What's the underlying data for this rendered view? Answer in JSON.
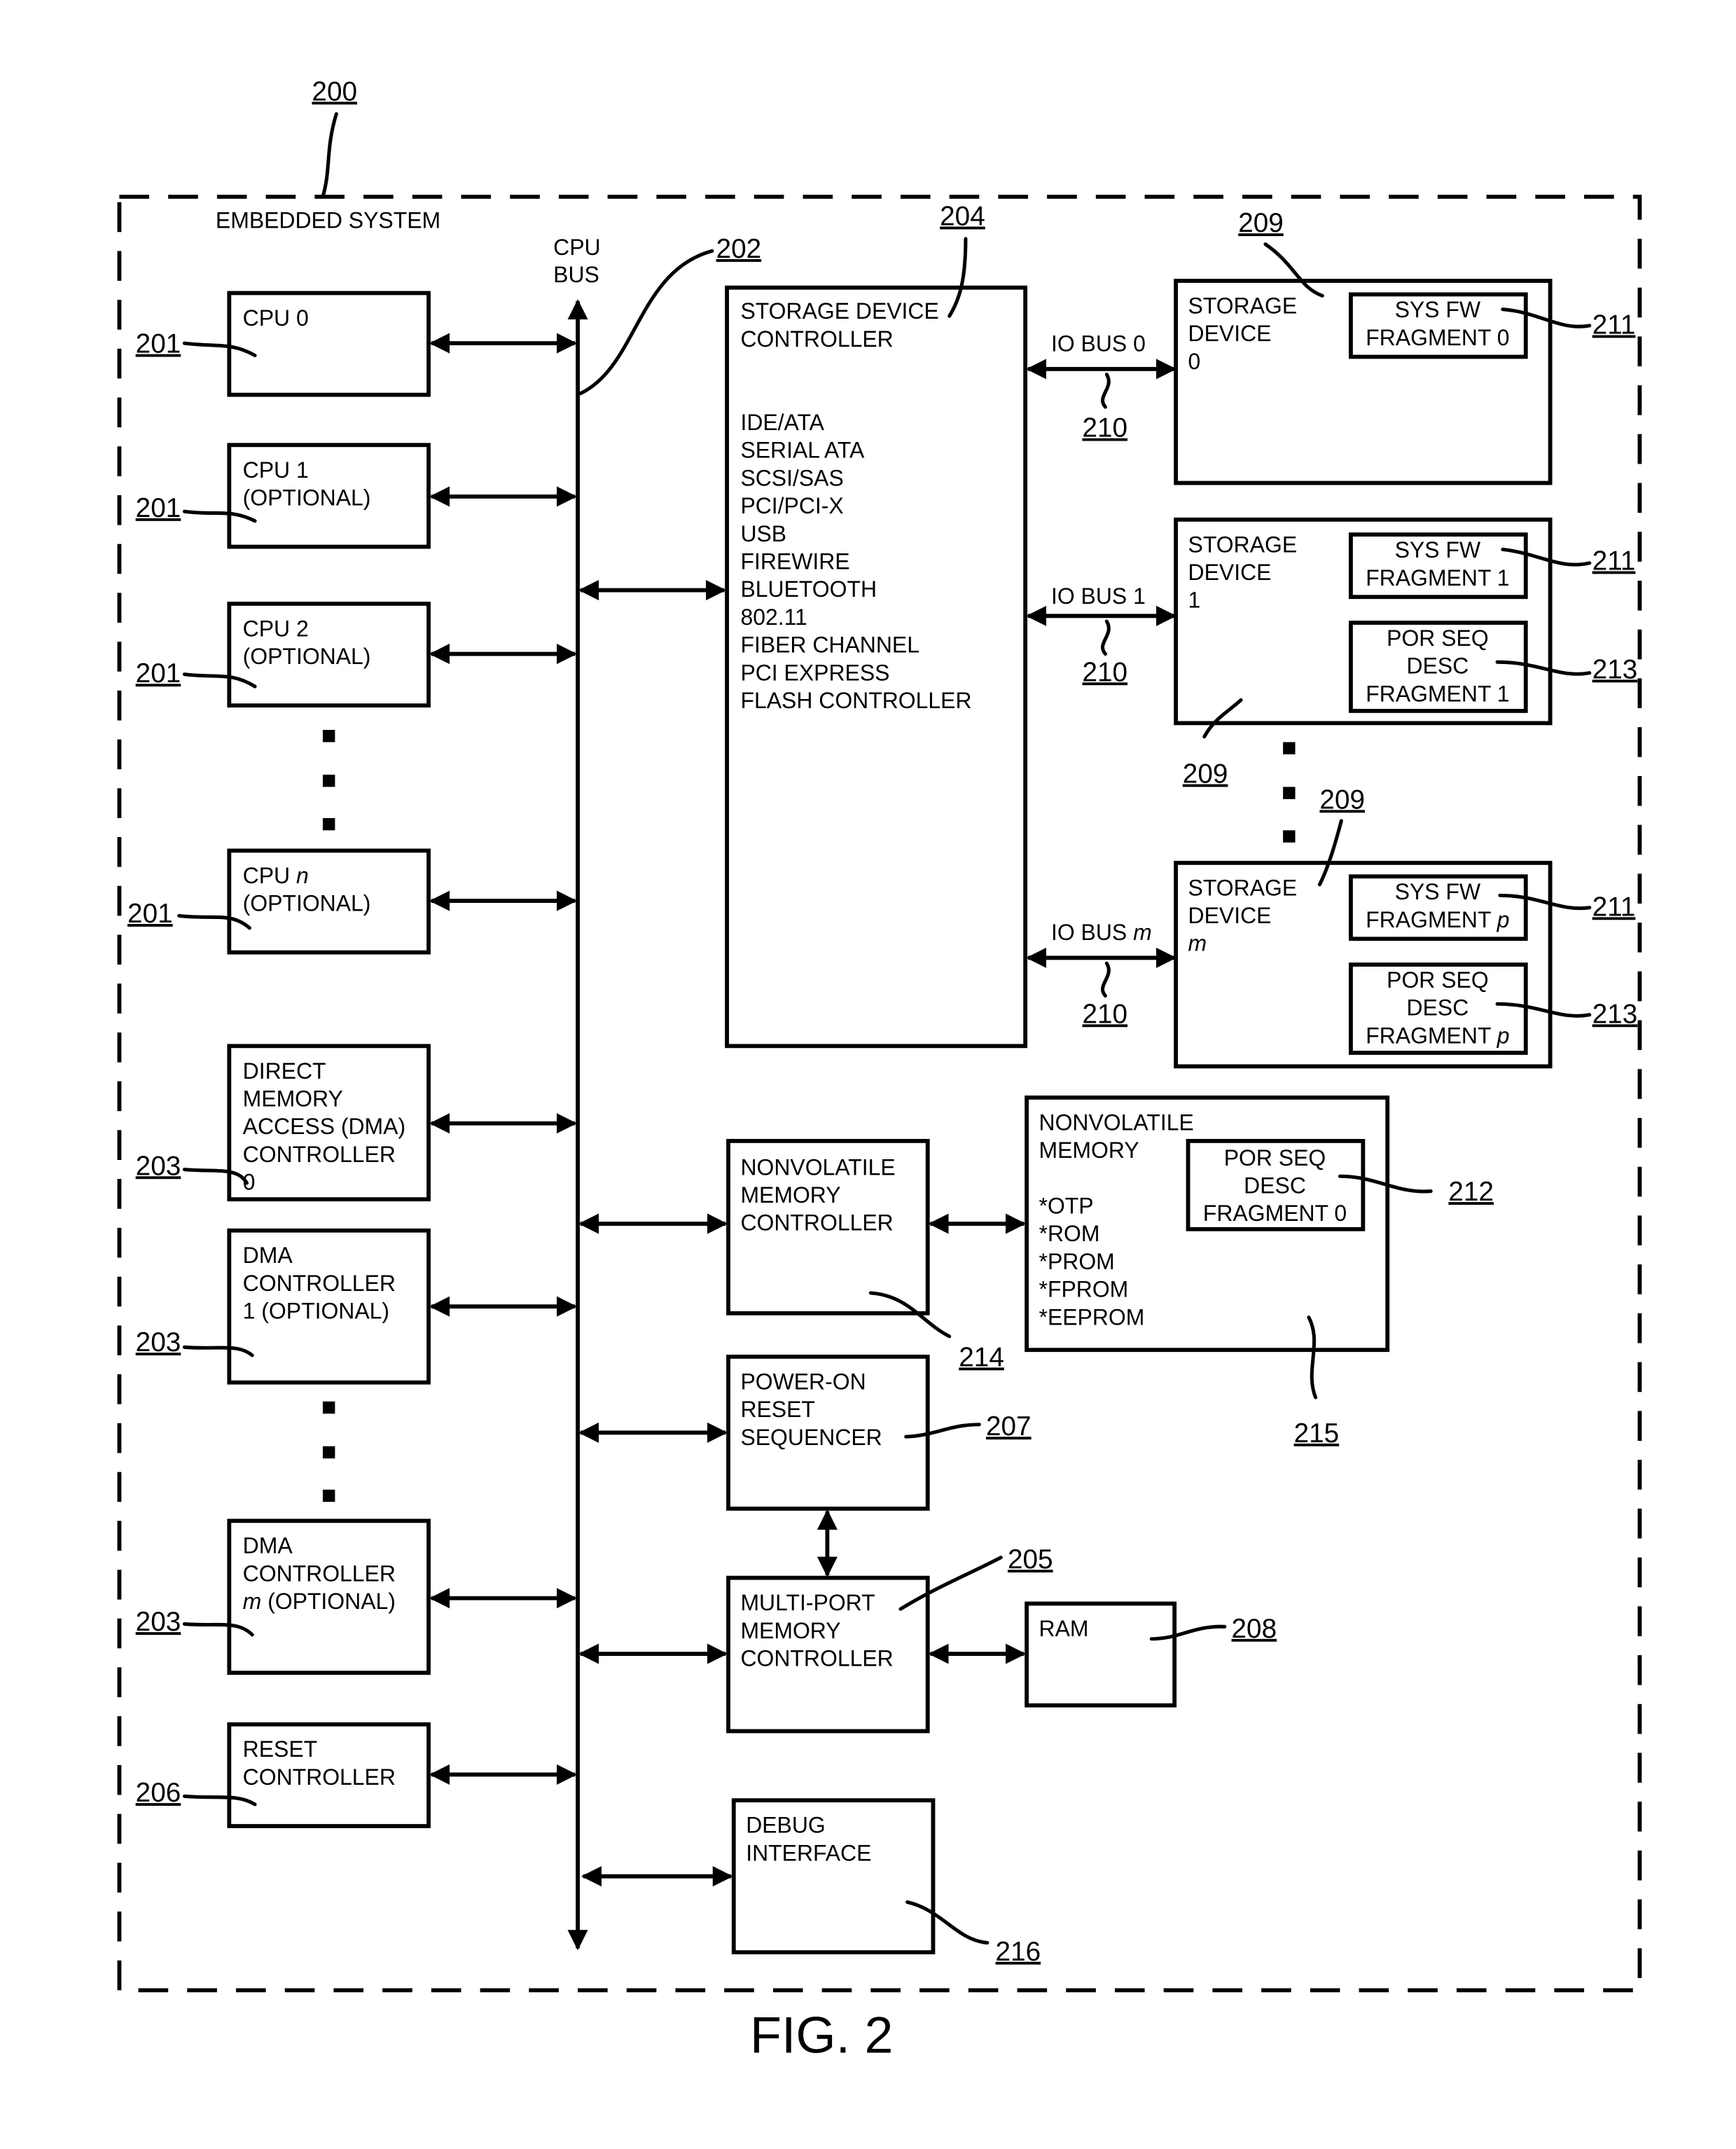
{
  "figure": {
    "caption": "FIG. 2",
    "system_ref": "200",
    "system_label": "EMBEDDED SYSTEM",
    "bus_label": [
      "CPU",
      "BUS"
    ],
    "bus_ref": "202"
  },
  "left_blocks": [
    {
      "id": "cpu0",
      "lines": [
        "CPU 0"
      ],
      "ref": "201"
    },
    {
      "id": "cpu1",
      "lines": [
        "CPU 1",
        "(OPTIONAL)"
      ],
      "ref": "201"
    },
    {
      "id": "cpu2",
      "lines": [
        "CPU 2",
        "(OPTIONAL)"
      ],
      "ref": "201"
    },
    {
      "id": "cpun",
      "lines": [
        "CPU n",
        "(OPTIONAL)"
      ],
      "ref": "201"
    },
    {
      "id": "dma0",
      "lines": [
        "DIRECT",
        "MEMORY",
        "ACCESS (DMA)",
        "CONTROLLER",
        "0"
      ],
      "ref": "203"
    },
    {
      "id": "dma1",
      "lines": [
        "DMA",
        "CONTROLLER",
        "1 (OPTIONAL)"
      ],
      "ref": "203"
    },
    {
      "id": "dmam",
      "lines": [
        "DMA",
        "CONTROLLER",
        "m (OPTIONAL)"
      ],
      "ref": "203"
    },
    {
      "id": "reset",
      "lines": [
        "RESET",
        "CONTROLLER"
      ],
      "ref": "206"
    }
  ],
  "storage_controller": {
    "title": [
      "STORAGE DEVICE",
      "CONTROLLER"
    ],
    "interfaces": [
      "IDE/ATA",
      "SERIAL ATA",
      "SCSI/SAS",
      "PCI/PCI-X",
      "USB",
      "FIREWIRE",
      "BLUETOOTH",
      "802.11",
      "FIBER CHANNEL",
      "PCI EXPRESS",
      "FLASH CONTROLLER"
    ],
    "ref": "204"
  },
  "io_buses": [
    {
      "label": "IO BUS 0",
      "ref": "210"
    },
    {
      "label": "IO BUS 1",
      "ref": "210"
    },
    {
      "label": "IO BUS m",
      "ref": "210"
    }
  ],
  "storage_devices": [
    {
      "lines": [
        "STORAGE",
        "DEVICE",
        "0"
      ],
      "ref": "209",
      "fw": {
        "lines": [
          "SYS FW",
          "FRAGMENT 0"
        ],
        "ref": "211"
      }
    },
    {
      "lines": [
        "STORAGE",
        "DEVICE",
        "1"
      ],
      "ref": "209",
      "fw": {
        "lines": [
          "SYS FW",
          "FRAGMENT 1"
        ],
        "ref": "211"
      },
      "por": {
        "lines": [
          "POR SEQ",
          "DESC",
          "FRAGMENT 1"
        ],
        "ref": "213"
      }
    },
    {
      "lines": [
        "STORAGE",
        "DEVICE",
        "m"
      ],
      "ref": "209",
      "fw": {
        "lines": [
          "SYS FW",
          "FRAGMENT p"
        ],
        "ref": "211"
      },
      "por": {
        "lines": [
          "POR SEQ",
          "DESC",
          "FRAGMENT p"
        ],
        "ref": "213"
      }
    }
  ],
  "nvm_controller": {
    "lines": [
      "NONVOLATILE",
      "MEMORY",
      "CONTROLLER"
    ],
    "ref": "214"
  },
  "nvm": {
    "lines": [
      "NONVOLATILE",
      "MEMORY",
      "",
      "*OTP",
      "*ROM",
      "*PROM",
      "*FPROM",
      "*EEPROM"
    ],
    "ref": "215",
    "por": {
      "lines": [
        "POR SEQ",
        "DESC",
        "FRAGMENT 0"
      ],
      "ref": "212"
    }
  },
  "por_sequencer": {
    "lines": [
      "POWER-ON",
      "RESET",
      "SEQUENCER"
    ],
    "ref": "207"
  },
  "mem_controller": {
    "lines": [
      "MULTI-PORT",
      "MEMORY",
      "CONTROLLER"
    ],
    "ref": "205"
  },
  "ram": {
    "lines": [
      "RAM"
    ],
    "ref": "208"
  },
  "debug": {
    "lines": [
      "DEBUG",
      "INTERFACE"
    ],
    "ref": "216"
  }
}
